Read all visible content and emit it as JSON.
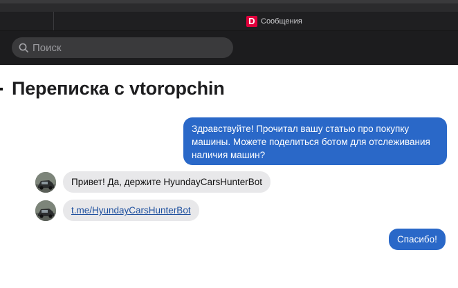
{
  "app": {
    "title": "Сообщения",
    "logo_letter": "D"
  },
  "search": {
    "placeholder": "Поиск"
  },
  "conversation": {
    "title": "Переписка с vtoropchin",
    "messages": [
      {
        "direction": "outgoing",
        "text": "Здравствуйте! Прочитал вашу статью про покупку машины. Можете поделиться ботом для отслеживания наличия машин?"
      },
      {
        "direction": "incoming",
        "text": "Привет! Да, держите HyundayCarsHunterBot"
      },
      {
        "direction": "incoming",
        "text": "t.me/HyundayCarsHunterBot",
        "is_link": true
      },
      {
        "direction": "outgoing",
        "text": "Спасибо!"
      }
    ]
  },
  "colors": {
    "outgoing_bubble": "#2a68c8",
    "incoming_bubble": "#e8e8ea",
    "logo": "#e0003c",
    "toolbar": "#1c1c1e"
  },
  "icons": {
    "search": "magnifier-icon",
    "avatar": "car-photo"
  }
}
